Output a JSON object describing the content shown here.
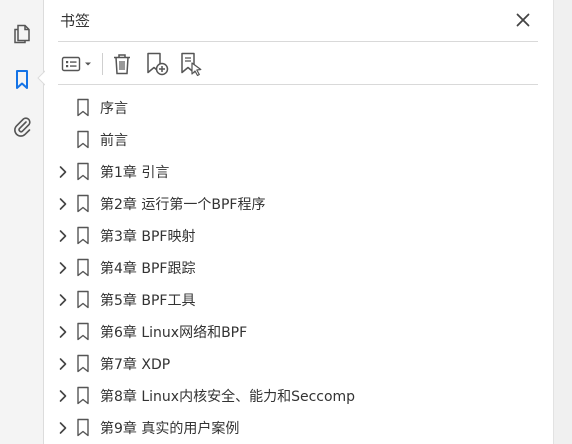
{
  "rail": {
    "items": [
      {
        "icon": "pages-icon"
      },
      {
        "icon": "bookmark-icon",
        "active": true
      },
      {
        "icon": "paperclip-icon"
      }
    ],
    "accent_color": "#1473e6"
  },
  "panel": {
    "title": "书签"
  },
  "toolbar": {
    "options_icon": "list-options-icon",
    "delete_icon": "trash-icon",
    "new_bookmark_icon": "bookmark-add-icon",
    "new_from_selection_icon": "bookmark-selection-icon"
  },
  "bookmarks": [
    {
      "label": "序言",
      "expandable": false
    },
    {
      "label": "前言",
      "expandable": false
    },
    {
      "label": "第1章  引言",
      "expandable": true
    },
    {
      "label": "第2章  运行第一个BPF程序",
      "expandable": true
    },
    {
      "label": "第3章  BPF映射",
      "expandable": true
    },
    {
      "label": "第4章  BPF跟踪",
      "expandable": true
    },
    {
      "label": "第5章  BPF工具",
      "expandable": true
    },
    {
      "label": "第6章  Linux网络和BPF",
      "expandable": true
    },
    {
      "label": "第7章  XDP",
      "expandable": true
    },
    {
      "label": "第8章  Linux内核安全、能力和Seccomp",
      "expandable": true
    },
    {
      "label": "第9章  真实的用户案例",
      "expandable": true
    }
  ]
}
